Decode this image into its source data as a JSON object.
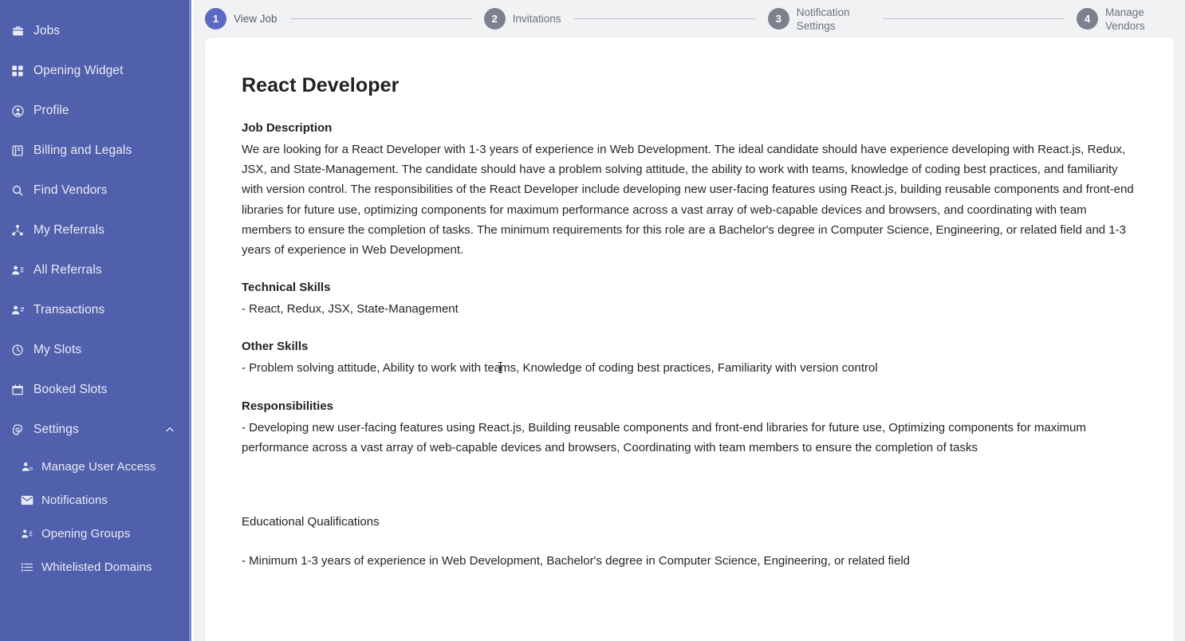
{
  "sidebar": {
    "accent_color": "#5160ac",
    "items": [
      {
        "label": "Jobs",
        "icon": "briefcase-icon",
        "level": "top"
      },
      {
        "label": "Opening Widget",
        "icon": "grid-icon",
        "level": "top"
      },
      {
        "label": "Profile",
        "icon": "user-circle-icon",
        "level": "top"
      },
      {
        "label": "Billing and Legals",
        "icon": "book-icon",
        "level": "top"
      },
      {
        "label": "Find Vendors",
        "icon": "search-icon",
        "level": "top"
      },
      {
        "label": "My Referrals",
        "icon": "share-nodes-icon",
        "level": "top"
      },
      {
        "label": "All Referrals",
        "icon": "users-gear-icon",
        "level": "top"
      },
      {
        "label": "Transactions",
        "icon": "users-arrow-icon",
        "level": "top"
      },
      {
        "label": "My Slots",
        "icon": "clock-icon",
        "level": "top"
      },
      {
        "label": "Booked Slots",
        "icon": "calendar-check-icon",
        "level": "top"
      },
      {
        "label": "Settings",
        "icon": "gear-icon",
        "level": "top",
        "expanded": true,
        "chevron": "chevron-up-icon"
      },
      {
        "label": "Manage User Access",
        "icon": "user-add-icon",
        "level": "sub"
      },
      {
        "label": "Notifications",
        "icon": "envelope-icon",
        "level": "sub"
      },
      {
        "label": "Opening Groups",
        "icon": "user-group-icon",
        "level": "sub"
      },
      {
        "label": "Whitelisted Domains",
        "icon": "list-icon",
        "level": "sub"
      }
    ]
  },
  "stepper": {
    "active_color": "#5b6ac2",
    "inactive_color": "#7b828e",
    "steps": [
      {
        "number": "1",
        "label": "View Job",
        "active": true
      },
      {
        "number": "2",
        "label": "Invitations",
        "active": false
      },
      {
        "number": "3",
        "label": "Notification Settings",
        "active": false
      },
      {
        "number": "4",
        "label": "Manage Vendors",
        "active": false
      }
    ]
  },
  "job": {
    "title": "React Developer",
    "description_heading": "Job Description",
    "description": "We are looking for a React Developer with 1-3 years of experience in Web Development. The ideal candidate should have experience developing with React.js, Redux, JSX, and State-Management. The candidate should have a problem solving attitude, the ability to work with teams, knowledge of coding best practices, and familiarity with version control. The responsibilities of the React Developer include developing new user-facing features using React.js, building reusable components and front-end libraries for future use, optimizing components for maximum performance across a vast array of web-capable devices and browsers, and coordinating with team members to ensure the completion of tasks. The minimum requirements for this role are a Bachelor's degree in Computer Science, Engineering, or related field and 1-3 years of experience in Web Development.",
    "technical_skills_heading": "Technical Skills",
    "technical_skills": "- React, Redux, JSX, State-Management",
    "other_skills_heading": "Other Skills",
    "other_skills_part1": "- Problem solving attitude, Ability to work with tea",
    "other_skills_part2": "ms, Knowledge of coding best practices, Familiarity with version control",
    "responsibilities_heading": "Responsibilities",
    "responsibilities": "- Developing new user-facing features using React.js, Building reusable components and front-end libraries for future use, Optimizing components for maximum performance across a vast array of web-capable devices and browsers, Coordinating with team members to ensure the completion of tasks",
    "education_heading": "Educational Qualifications",
    "education": "- Minimum 1-3 years of experience in Web Development, Bachelor's degree in Computer Science, Engineering, or related field"
  }
}
